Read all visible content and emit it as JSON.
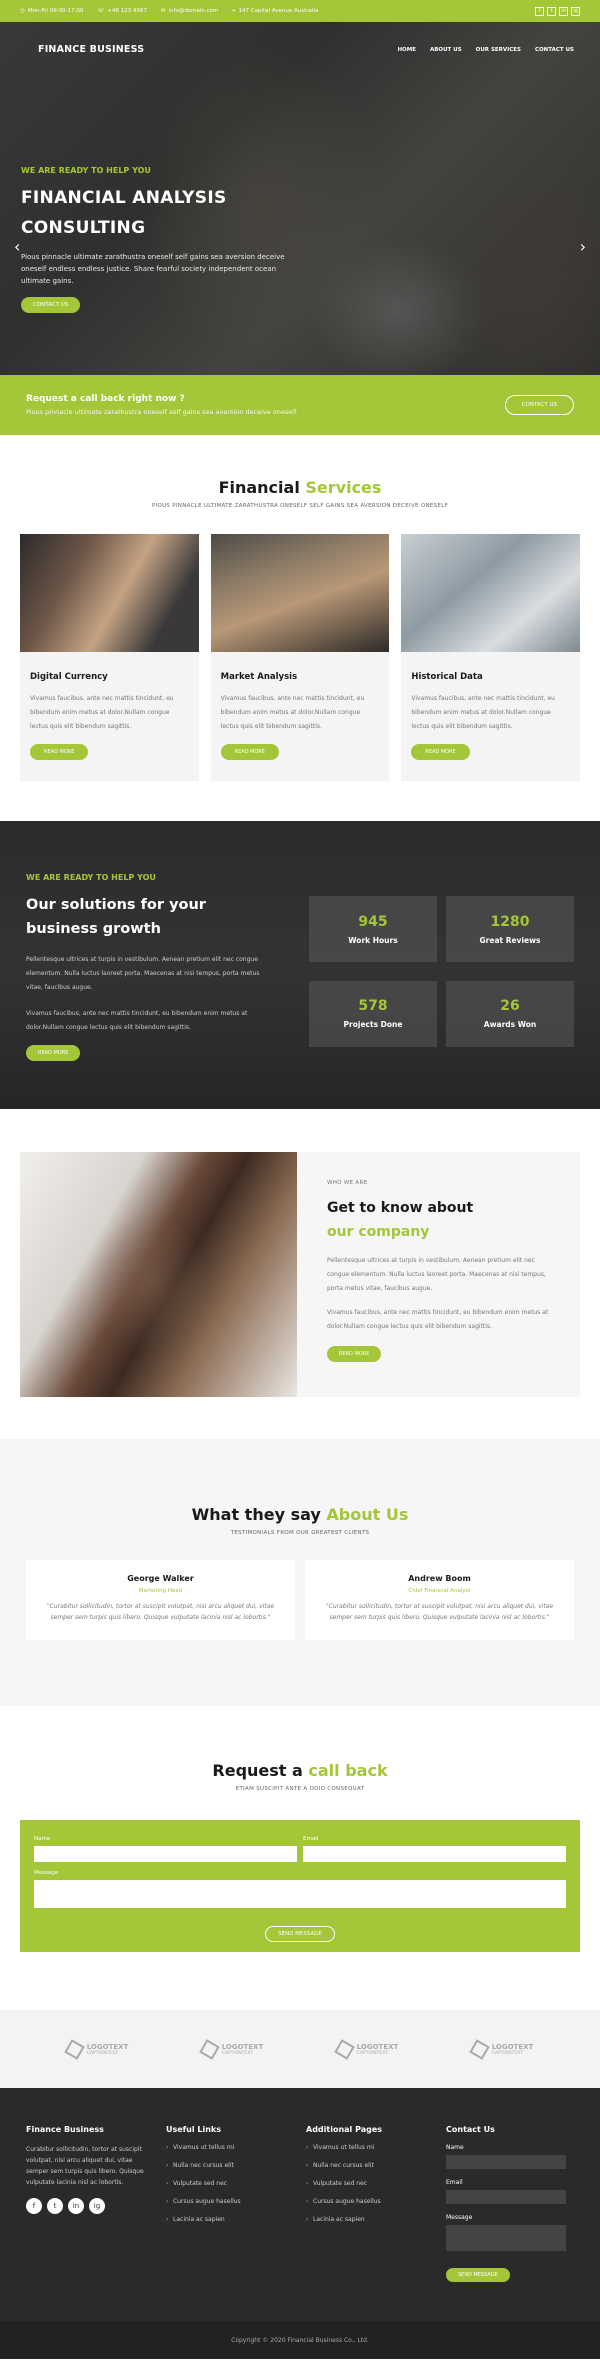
{
  "topbar": {
    "hours": "Mon-Fri 09:00-17:00",
    "phone": "+48 123 4567",
    "email": "info@domain.com",
    "address": "147 Capital Avenue Australia",
    "social": [
      "f",
      "t",
      "in",
      "ig"
    ]
  },
  "nav": {
    "brand": "FINANCE BUSINESS",
    "items": [
      "HOME",
      "ABOUT US",
      "OUR SERVICES",
      "CONTACT US"
    ]
  },
  "hero": {
    "kicker": "WE ARE READY TO HELP YOU",
    "title_line1": "FINANCIAL ANALYSIS",
    "title_line2": "CONSULTING",
    "text": "Pious pinnacle ultimate zarathustra oneself self gains sea aversion deceive oneself endless endless justice. Share fearful society independent ocean ultimate gains.",
    "button": "CONTACT US",
    "prev": "‹",
    "next": "›"
  },
  "cta": {
    "title": "Request a call back right now ?",
    "text": "Pious pinnacle ultimate zarathustra oneself self gains sea aversion deceive oneself",
    "button": "CONTACT US"
  },
  "services": {
    "title_a": "Financial",
    "title_b": "Services",
    "subtitle": "PIOUS PINNACLE ULTIMATE ZARATHUSTRA ONESELF SELF GAINS SEA AVERSION DECEIVE ONESELF",
    "cards": [
      {
        "title": "Digital Currency",
        "text": "Vivamus faucibus, ante nec mattis tincidunt, eu bibendum enim metus at dolor.Nullam congue lectus quis elit bibendum sagittis.",
        "button": "READ MORE"
      },
      {
        "title": "Market Analysis",
        "text": "Vivamus faucibus, ante nec mattis tincidunt, eu bibendum enim metus at dolor.Nullam congue lectus quis elit bibendum sagittis.",
        "button": "READ MORE"
      },
      {
        "title": "Historical Data",
        "text": "Vivamus faucibus, ante nec mattis tincidunt, eu bibendum enim metus at dolor.Nullam congue lectus quis elit bibendum sagittis.",
        "button": "READ MORE"
      }
    ]
  },
  "solutions": {
    "kicker": "WE ARE READY TO HELP YOU",
    "title": "Our solutions for your business growth",
    "p1": "Pellentesque ultrices at turpis in vestibulum. Aenean pretium elit nec congue elementum. Nulla luctus laoreet porta. Maecenas at nisi tempus, porta metus vitae, faucibus augue.",
    "p2": "Vivamus faucibus, ante nec mattis tincidunt, eu bibendum enim metus at dolor.Nullam congue lectus quis elit bibendum sagittis.",
    "button": "READ MORE",
    "stats": [
      {
        "num": "945",
        "label": "Work Hours"
      },
      {
        "num": "1280",
        "label": "Great Reviews"
      },
      {
        "num": "578",
        "label": "Projects Done"
      },
      {
        "num": "26",
        "label": "Awards Won"
      }
    ]
  },
  "about": {
    "kicker": "WHO WE ARE",
    "title_a": "Get to know about",
    "title_b": "our company",
    "p1": "Pellentesque ultrices at turpis in vestibulum. Aenean pretium elit nec congue elementum. Nulla luctus laoreet porta. Maecenas at nisi tempus, porta metus vitae, faucibus augue.",
    "p2": "Vivamus faucibus, ante nec mattis tincidunt, eu bibendum enim metus at dolor.Nullam congue lectus quis elit bibendum sagittis.",
    "button": "READ MORE"
  },
  "testimonials": {
    "title_a": "What they say",
    "title_b": "About Us",
    "subtitle": "TESTIMONIALS FROM OUR GREATEST CLIENTS",
    "items": [
      {
        "name": "George Walker",
        "role": "Marketing Head",
        "quote": "\"Curabitur sollicitudin, tortor at suscipit volutpat, nisi arcu aliquet dui, vitae semper sem turpis quis libero. Quisque vulputate lacinia nisl ac lobortis.\""
      },
      {
        "name": "Andrew Boom",
        "role": "Chief Financial Analyst",
        "quote": "\"Curabitur sollicitudin, tortor at suscipit volutpat, nisi arcu aliquet dui, vitae semper sem turpis quis libero. Quisque vulputate lacinia nisl ac lobortis.\""
      }
    ]
  },
  "callback": {
    "title_a": "Request a",
    "title_b": "call back",
    "subtitle": "ETIAM SUSCIPIT ANTE A ODIO CONSEQUAT",
    "name_label": "Name",
    "email_label": "Email",
    "message_label": "Message",
    "button": "SEND MESSAGE"
  },
  "logos": [
    {
      "name": "LOGOTEXT",
      "tag": "CAPTIONTEXT"
    },
    {
      "name": "LOGOTEXT",
      "tag": "CAPTIONTEXT"
    },
    {
      "name": "LOGOTEXT",
      "tag": "CAPTIONTEXT"
    },
    {
      "name": "LOGOTEXT",
      "tag": "CAPTIONTEXT"
    }
  ],
  "footer": {
    "about_title": "Finance Business",
    "about_text": "Curabitur sollicitudin, tortor at suscipit volutpat, nisi arcu aliquet dui, vitae semper sem turpis quis libero. Quisque vulputate lacinia nisl ac lobortis.",
    "social": [
      "f",
      "t",
      "in",
      "ig"
    ],
    "links_title": "Useful Links",
    "links": [
      "Vivamus ut tellus mi",
      "Nulla nec cursus elit",
      "Vulputate sed nec",
      "Cursus augue hasellus",
      "Lacinia ac sapien"
    ],
    "pages_title": "Additional Pages",
    "pages": [
      "Vivamus ut tellus mi",
      "Nulla nec cursus elit",
      "Vulputate sed nec",
      "Cursus augue hasellus",
      "Lacinia ac sapien"
    ],
    "contact_title": "Contact Us",
    "name_label": "Name",
    "email_label": "Email",
    "message_label": "Message",
    "button": "SEND MESSAGE",
    "copyright": "Copyright © 2020 Financial Business Co., Ltd."
  }
}
